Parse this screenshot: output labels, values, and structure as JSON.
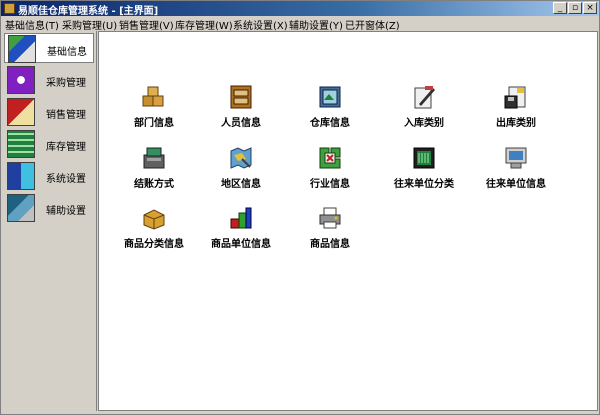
{
  "window": {
    "title": "易顺佳仓库管理系统 - [主界面]"
  },
  "window_buttons": {
    "minimize": "_",
    "restore": "▫",
    "close": "×"
  },
  "menu": [
    "基础信息(T)",
    "采购管理(U)",
    "销售管理(V)",
    "库存管理(W)",
    "系统设置(X)",
    "辅助设置(Y)",
    "已开窗体(Z)"
  ],
  "sidebar": [
    {
      "label": "基础信息",
      "icon": "basic-info-icon",
      "active": true
    },
    {
      "label": "采购管理",
      "icon": "purchase-icon"
    },
    {
      "label": "销售管理",
      "icon": "sales-icon"
    },
    {
      "label": "库存管理",
      "icon": "inventory-icon"
    },
    {
      "label": "系统设置",
      "icon": "settings-icon"
    },
    {
      "label": "辅助设置",
      "icon": "assist-icon"
    }
  ],
  "tiles": [
    {
      "label": "部门信息",
      "icon": "boxes-icon"
    },
    {
      "label": "人员信息",
      "icon": "cabinet-icon"
    },
    {
      "label": "仓库信息",
      "icon": "warehouse-icon"
    },
    {
      "label": "入库类别",
      "icon": "pen-doc-icon"
    },
    {
      "label": "出库类别",
      "icon": "disk-doc-icon"
    },
    {
      "label": "结账方式",
      "icon": "register-icon"
    },
    {
      "label": "地区信息",
      "icon": "map-icon"
    },
    {
      "label": "行业信息",
      "icon": "puzzle-icon"
    },
    {
      "label": "往来单位分类",
      "icon": "chip-icon"
    },
    {
      "label": "往来单位信息",
      "icon": "monitor-icon"
    },
    {
      "label": "商品分类信息",
      "icon": "box-open-icon"
    },
    {
      "label": "商品单位信息",
      "icon": "blocks-icon"
    },
    {
      "label": "商品信息",
      "icon": "printer-icon"
    }
  ]
}
